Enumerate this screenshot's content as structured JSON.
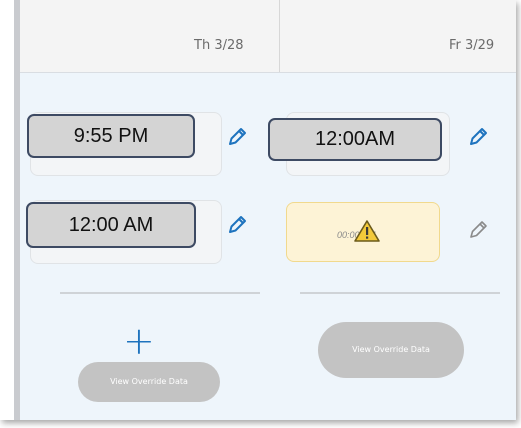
{
  "columns": [
    {
      "header": "Th 3/28"
    },
    {
      "header": "Fr 3/29"
    }
  ],
  "rows": {
    "row1": {
      "thu_time": "9:55 PM",
      "fri_time": "12:00AM"
    },
    "row2": {
      "thu_time": "12:00 AM",
      "fri_time_faint": "00:00 PM",
      "fri_status": "warning"
    }
  },
  "actions": {
    "add_icon": "plus-icon",
    "view_override_label": "View Override Data"
  },
  "colors": {
    "accent_blue": "#1e73be",
    "callout_border": "#3d4a63",
    "warning_fill": "#fdf3d6",
    "pill_gray": "#c3c3c3"
  }
}
